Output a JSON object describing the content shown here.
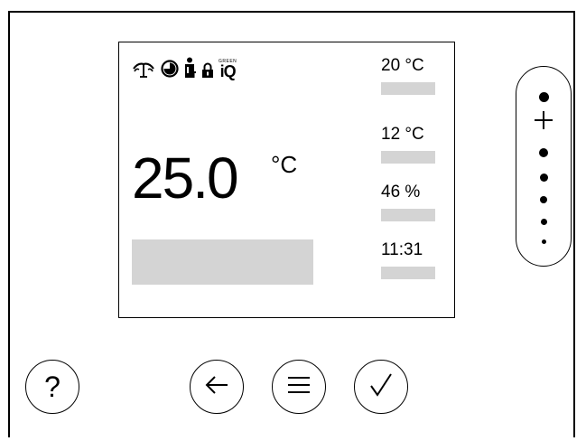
{
  "display": {
    "main_temperature": "25.0",
    "main_unit": "°C",
    "side_values": [
      "20 °C",
      "12 °C",
      "46 %",
      "11:31"
    ]
  },
  "status_icons": [
    "chimney-sweep-icon",
    "timer-program-icon",
    "service-technician-icon",
    "lock-icon",
    "green-iq-icon"
  ],
  "green_iq": {
    "top": "GREEN",
    "main": "iQ"
  },
  "volume_control": {
    "plus_label": "+"
  },
  "buttons": {
    "help_label": "?",
    "back_icon": "arrow-left-icon",
    "menu_icon": "hamburger-menu-icon",
    "confirm_icon": "checkmark-icon"
  }
}
